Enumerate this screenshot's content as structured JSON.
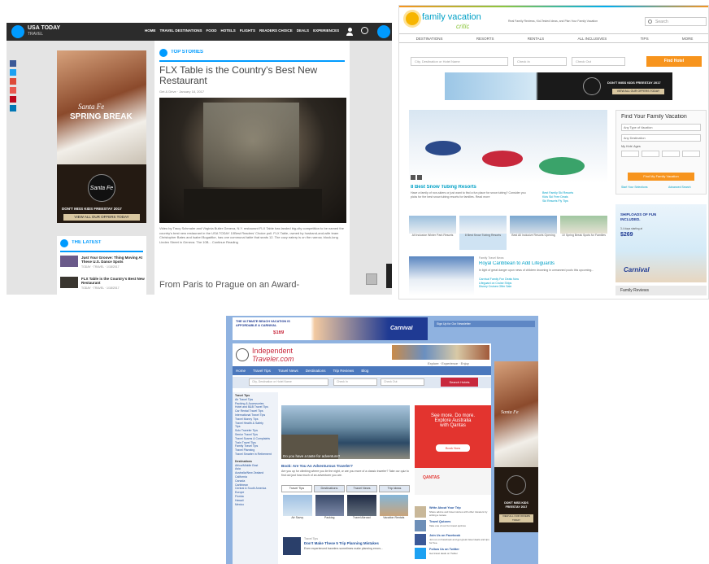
{
  "usatoday": {
    "logo": "USA TODAY",
    "logo_sub": "TRAVEL",
    "nav": [
      "HOME",
      "TRAVEL DESTINATIONS",
      "FOOD",
      "HOTELS",
      "FLIGHTS",
      "READERS CHOICE",
      "DEALS",
      "EXPERIENCES"
    ],
    "top_stories_label": "TOP STORIES",
    "headline": "FLX Table is the Country's Best New Restaurant",
    "byline": "Get & Drive · January 18, 2017",
    "body": "Video by Tracy Schmaler and Virginia Butler Geneva, N.Y. restaurant FLX Table has landed big-city competition to be named the country's best new restaurant in the USA TODAY 10Best Readers' Choice poll. FLX Table, owned by husband-and-wife team Christopher Bates and Isabel Bogadtke, has one communal table that seats 12. The cozy eatery is on the narrow, block-long Linden Street in Geneva. The 10B... Continue Reading",
    "next_headline": "From Paris to Prague on an Award-",
    "latest_label": "THE LATEST",
    "latest": [
      {
        "title": "Just Your Groove: Thing Moving At These U.S. Dance Spots",
        "date": "TODAY · TRAVEL · 1/18/2017"
      },
      {
        "title": "FLX Table is the Country's Best New Restaurant",
        "date": "TODAY · TRAVEL · 1/18/2017"
      }
    ],
    "ad": {
      "line1": "Santa Fe",
      "line2": "SPRING BREAK",
      "brand": "Santa Fe",
      "cta1": "DON'T MISS KIDS FREESTAY 2017",
      "cta2": "VIEW ALL OUR OFFERS TODAY"
    },
    "share_colors": [
      "#3b5998",
      "#1da1f2",
      "#dd4b39",
      "#e95950",
      "#bd081c",
      "#0077b5"
    ]
  },
  "fvc": {
    "logo_main": "family vacation",
    "logo_sub": "critic",
    "tagline": "Real Family Reviews, Kid-Tested Ideas, and Plan Your Family Vacation",
    "search_placeholder": "Search",
    "nav": [
      "DESTINATIONS",
      "RESORTS",
      "RENTALS",
      "ALL INCLUSIVES",
      "TIPS",
      "MORE"
    ],
    "dest_placeholder": "City, Destination or Hotel Name",
    "checkin": "Check In",
    "checkout": "Check Out",
    "find_button": "Find Hotel",
    "banner_cta1": "DON'T MISS KIDS FREESTAY 2017",
    "banner_cta2": "VIEW ALL OUR OFFERS TODAY",
    "hero_caption": "8 Best Snow Tubing Resorts",
    "hero_text": "Have a family of non-skiers or just want to find a fun place for snow tubing? Consider you picks for the best snow tubing resorts for families. Read more",
    "hero_links": [
      "Best Family Ski Resorts",
      "Kids Ski Free Deals",
      "Ski Resorts Fly Tips"
    ],
    "thumbs": [
      "All Inclusive Winter Park Resorts",
      "8 Best Snow Tubing Resorts",
      "Best All Inclusive Resorts Opening",
      "10 Spring Break Spots for Families"
    ],
    "story_tag": "Family Travel News",
    "story_title": "Royal Caribbean to Add Lifeguards",
    "story_text": "In light of great danger upon news of children drowning in unmanned pools this upcoming...",
    "story_links": [
      "Carnival Family Fun Deals Now",
      "Lifeguard on Cruise Ships",
      "Disney Cruises Offer Sale"
    ],
    "finder_title": "Find Your Family Vacation",
    "finder_selects": [
      "Any Type of Vacation",
      "Any Destination"
    ],
    "finder_ages_label": "My Kids' Ages",
    "finder_button": "Find My Family Vacation",
    "finder_links": [
      "Start Your Selections",
      "Advanced Search"
    ],
    "carnival_text": "SHIPLOADS OF FUN INCLUDED.",
    "carnival_price": "$269",
    "carnival_from": "3-4 days starting at",
    "carnival_brand": "Carnival",
    "reviews_label": "Family Reviews"
  },
  "itr": {
    "top_ad": "THE ULTIMATE BEACH VACATION IS AFFORDABLE & CARNIVAL",
    "top_ad_price": "$169",
    "top_ad_brand": "Carnival",
    "signup": "Sign Up for Our Newsletter",
    "logo1": "Independent",
    "logo2": "Traveler.com",
    "tagline": "Explore · Experience · Enjoy",
    "nav": [
      "Home",
      "Travel Tips",
      "Travel News",
      "Destinations",
      "Trip Reviews",
      "Blog"
    ],
    "search_placeholder": "City, Destination or Hotel Name",
    "checkin": "Check In",
    "checkout": "Check Out",
    "search_button": "Search Hotels",
    "travel_tips_label": "Travel Tips",
    "tips_links": [
      "Air Travel Tips",
      "Packing & Accessories",
      "Hotel and B&B Travel Tips",
      "Car Rental Travel Tips",
      "International Travel Tips",
      "Travel Money Tips",
      "Travel Health & Safety",
      "Tips",
      "Solo Traveler Tips",
      "Senior Travel Tips",
      "Travel Scams & Complaints",
      "Train Travel Tips",
      "Family Travel Tips",
      "Travel Planning",
      "Travel Smarter in Retirement"
    ],
    "destinations_label": "Destinations",
    "dest_links": [
      "Africa/Middle East",
      "Asia",
      "Australia/New Zealand",
      "California",
      "Canada",
      "Caribbean",
      "Central & South America",
      "Europe",
      "Florida",
      "Hawaii",
      "Mexico"
    ],
    "hero_caption": "Do you have a taste for adventure?",
    "article_title": "Book: Are You An Adventurous Traveler?",
    "article_text": "Are you up for climbing where you lie the night, or are you more of a classic traveler? Take our quiz to find out just how much of an adventurer you are.",
    "tabs": [
      "Travel Tips",
      "Destinations",
      "Travel News",
      "Trip Ideas"
    ],
    "tiles": [
      "Air Savvy",
      "Packing",
      "Travel Abroad",
      "Vacation Rentals"
    ],
    "story_tag": "Travel Tips",
    "story_title": "Don't Make These 5 Trip Planning Mistakes",
    "story_text": "Even experienced travelers sometimes make planning errors...",
    "ad_lines": [
      "See more. Do more.",
      "Explore Australia",
      "with Qantas"
    ],
    "ad_button": "Book Now",
    "ad_brand": "QANTAS",
    "side_items": [
      {
        "title": "Write About Your Trip",
        "text": "Share advice and travel stories with other travelers by writing a review."
      },
      {
        "title": "Travel Quizzes",
        "text": "Take one of our fun travel quizzes"
      },
      {
        "title": "Join Us on Facebook",
        "text": "Join us on Facebook and get great travel deals and tips for free."
      },
      {
        "title": "Follow Us on Twitter",
        "text": "Get travel deals on Twitter"
      }
    ],
    "sky_ad": {
      "line": "Santa Fe",
      "cta1": "DON'T MISS KIDS FREESTAY 2017",
      "cta2": "VIEW ALL OUR OFFERS TODAY"
    }
  }
}
